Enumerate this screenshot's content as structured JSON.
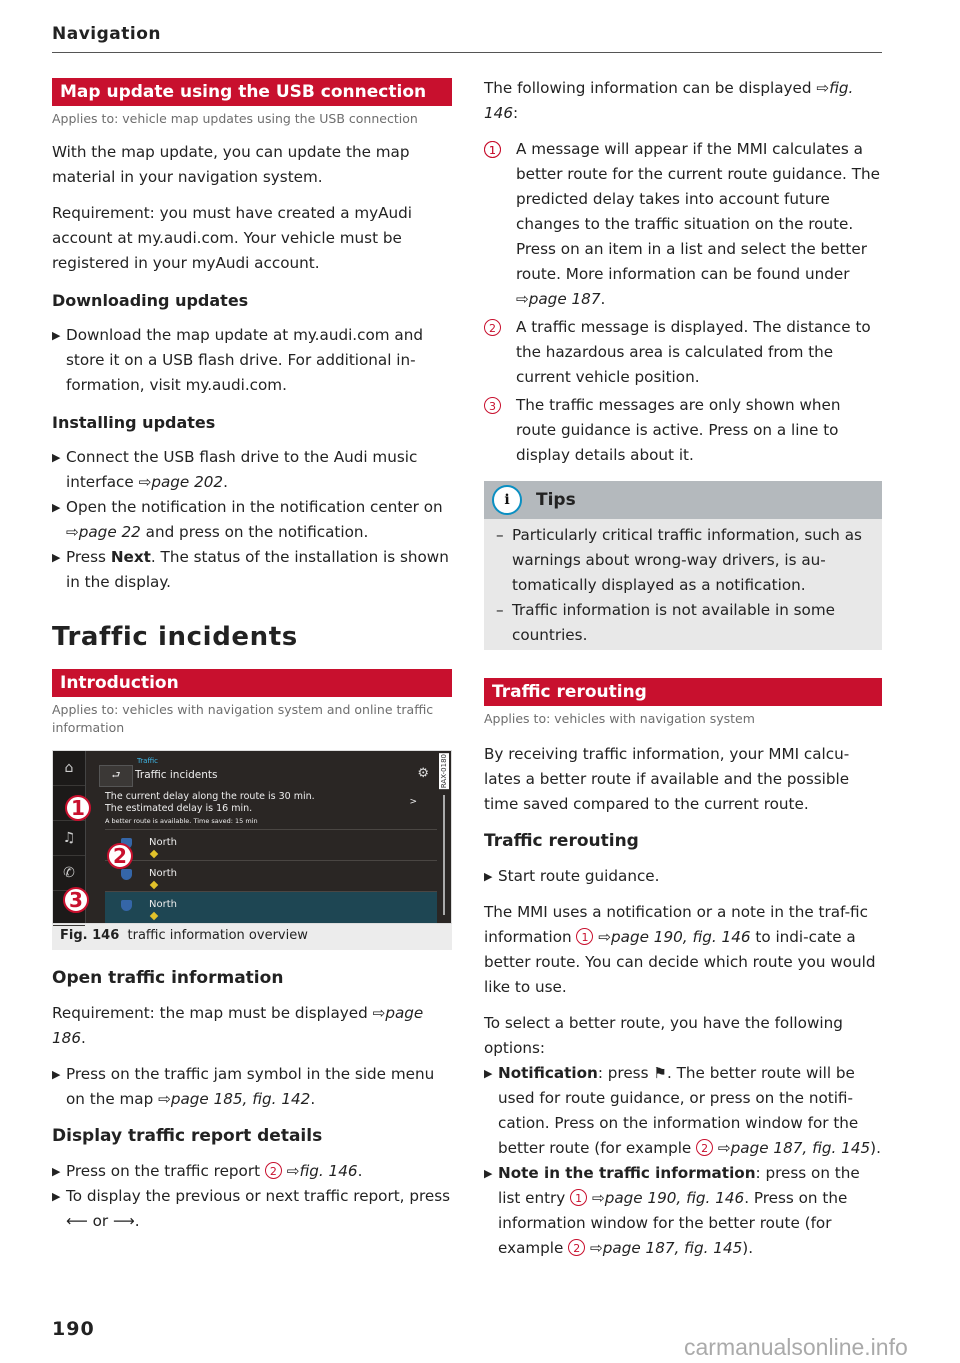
{
  "header": {
    "section": "Navigation"
  },
  "left": {
    "map_update": {
      "title": "Map update using the USB connection",
      "applies": "Applies to: vehicle map updates using the USB connection",
      "intro": "With the map update, you can update the map material in your navigation system.",
      "requirement": "Requirement: you must have created a myAudi account at my.audi.com. Your vehicle must be registered in your myAudi account.",
      "downloading_heading": "Downloading updates",
      "downloading_step": "Download the map update at my.audi.com and store it on a USB flash drive. For additional in-formation, visit my.audi.com.",
      "installing_heading": "Installing updates",
      "install_step1_text": "Connect the USB flash drive to the Audi music interface ",
      "install_step1_ref": "page 202",
      "install_step2_text": "Open the notification in the notification center on ",
      "install_step2_ref": "page 22",
      "install_step2_tail": " and press on the notification.",
      "install_step3_pre": "Press ",
      "install_step3_bold": "Next",
      "install_step3_tail": ". The status of the installation is shown in the display."
    },
    "traffic_incidents_title": "Traffic incidents",
    "introduction": {
      "title": "Introduction",
      "applies": "Applies to: vehicles with navigation system and online traffic information"
    },
    "figure": {
      "caption_num": "Fig. 146",
      "caption_text": "traffic information overview",
      "screen": {
        "breadcrumb": "Traffic",
        "title": "Traffic incidents",
        "message_line1": "The current delay along the route is 30 min.",
        "message_line2": "The estimated delay is 16 min.",
        "message_line3": "A better route is available. Time saved: 15 min",
        "rows": [
          "North",
          "North",
          "North"
        ],
        "code": "RAX-0180",
        "callouts": [
          "1",
          "2",
          "3"
        ]
      }
    },
    "open_traffic": {
      "heading": "Open traffic information",
      "requirement": "Requirement: the map must be displayed ",
      "requirement_ref": "page 186",
      "step_text": "Press on the traffic jam symbol in the side menu on the map ",
      "step_ref": "page 185, fig. 142"
    },
    "display_details": {
      "heading": "Display traffic report details",
      "step1_text": "Press on the traffic report ",
      "step1_circ": "2",
      "step1_ref": "fig. 146",
      "step2_text": "To display the previous or next traffic report, press ",
      "step2_or": " or "
    }
  },
  "right": {
    "intro_text": "The following information can be displayed ",
    "intro_ref": "fig. 146",
    "items": [
      {
        "num": "1",
        "text": "A message will appear if the MMI calculates a better route for the current route guidance. The predicted delay takes into account future changes to the traffic situation on the route. Press on an item in a list ",
        "circ": "1",
        "tail": " and select the better route. More information can be found under ",
        "ref": "page 187"
      },
      {
        "num": "2",
        "text": "A traffic message is displayed. The distance to the hazardous area is calculated from the current vehicle position."
      },
      {
        "num": "3",
        "text": "The traffic messages are only shown when route guidance is active. Press on a line to display details about it."
      }
    ],
    "tips": {
      "title": "Tips",
      "items": [
        "Particularly critical traffic information, such as warnings about wrong-way drivers, is au-tomatically displayed as a notification.",
        "Traffic information is not available in some countries."
      ]
    },
    "rerouting": {
      "title": "Traffic rerouting",
      "applies": "Applies to: vehicles with navigation system",
      "intro": "By receiving traffic information, your MMI calcu-lates a better route if available and the possible time saved compared to the current route.",
      "heading": "Traffic rerouting",
      "step": "Start route guidance.",
      "para1_a": "The MMI uses a notification or a note in the traf-fic information ",
      "para1_circ": "1",
      "para1_ref": "page 190, fig. 146",
      "para1_b": " to indi-cate a better route. You can decide which route you would like to use.",
      "para2": "To select a better route, you have the following options:",
      "opt1_bold": "Notification",
      "opt1_a": ": press ",
      "opt1_b": ". The better route will be used for route guidance, or press on the notifi-cation. Press on the information window for the better route (for example ",
      "opt1_circ": "2",
      "opt1_ref": "page 187, fig. 145",
      "opt1_c": ").",
      "opt2_bold": "Note in the traffic information",
      "opt2_a": ": press on the list entry ",
      "opt2_circ": "1",
      "opt2_ref": "page 190, fig. 146",
      "opt2_b": ". Press on the information window for the better route (for example ",
      "opt2_circ2": "2",
      "opt2_ref2": "page 187, fig. 145",
      "opt2_c": ")."
    }
  },
  "footer": {
    "page_number": "190",
    "watermark": "carmanualsonline.info"
  },
  "colors": {
    "accent": "#c8102e",
    "tips_header": "#b4b9bd",
    "tips_bg": "#e8e8e8"
  }
}
